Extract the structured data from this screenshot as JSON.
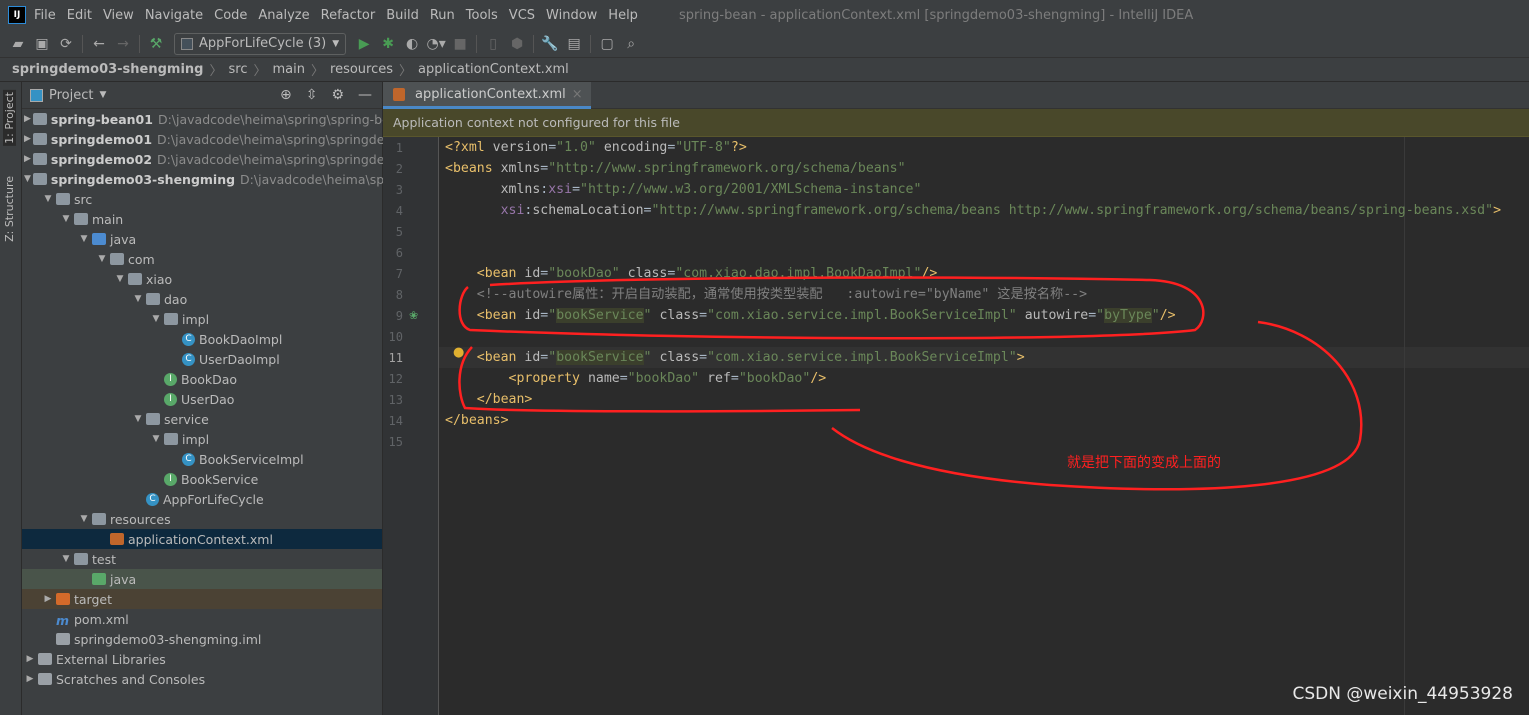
{
  "menubar": {
    "items": [
      "File",
      "Edit",
      "View",
      "Navigate",
      "Code",
      "Analyze",
      "Refactor",
      "Build",
      "Run",
      "Tools",
      "VCS",
      "Window",
      "Help"
    ],
    "window_title": "spring-bean - applicationContext.xml [springdemo03-shengming] - IntelliJ IDEA"
  },
  "toolbar": {
    "run_config": "AppForLifeCycle (3)"
  },
  "breadcrumb": [
    "springdemo03-shengming",
    "src",
    "main",
    "resources",
    "applicationContext.xml"
  ],
  "side_tabs": {
    "project": "1: Project",
    "structure": "Z: Structure"
  },
  "project_panel": {
    "title": "Project",
    "tree": [
      {
        "label": "spring-bean01",
        "path": "D:\\javadcode\\heima\\spring\\spring-bea",
        "level": 0,
        "icon": "module",
        "arrow": "right",
        "bold": true
      },
      {
        "label": "springdemo01",
        "path": "D:\\javadcode\\heima\\spring\\springdem",
        "level": 0,
        "icon": "module",
        "arrow": "right",
        "bold": true
      },
      {
        "label": "springdemo02",
        "path": "D:\\javadcode\\heima\\spring\\springdem",
        "level": 0,
        "icon": "module",
        "arrow": "right",
        "bold": true
      },
      {
        "label": "springdemo03-shengming",
        "path": "D:\\javadcode\\heima\\sprin",
        "level": 0,
        "icon": "module",
        "arrow": "down",
        "bold": true
      },
      {
        "label": "src",
        "level": 1,
        "icon": "folder",
        "arrow": "down"
      },
      {
        "label": "main",
        "level": 2,
        "icon": "folder",
        "arrow": "down"
      },
      {
        "label": "java",
        "level": 3,
        "icon": "source-folder",
        "arrow": "down"
      },
      {
        "label": "com",
        "level": 4,
        "icon": "folder",
        "arrow": "down"
      },
      {
        "label": "xiao",
        "level": 5,
        "icon": "folder",
        "arrow": "down"
      },
      {
        "label": "dao",
        "level": 6,
        "icon": "folder",
        "arrow": "down"
      },
      {
        "label": "impl",
        "level": 7,
        "icon": "folder",
        "arrow": "down"
      },
      {
        "label": "BookDaoImpl",
        "level": 8,
        "icon": "class"
      },
      {
        "label": "UserDaoImpl",
        "level": 8,
        "icon": "class"
      },
      {
        "label": "BookDao",
        "level": 7,
        "icon": "interface"
      },
      {
        "label": "UserDao",
        "level": 7,
        "icon": "interface"
      },
      {
        "label": "service",
        "level": 6,
        "icon": "folder",
        "arrow": "down"
      },
      {
        "label": "impl",
        "level": 7,
        "icon": "folder",
        "arrow": "down"
      },
      {
        "label": "BookServiceImpl",
        "level": 8,
        "icon": "class"
      },
      {
        "label": "BookService",
        "level": 7,
        "icon": "interface"
      },
      {
        "label": "AppForLifeCycle",
        "level": 6,
        "icon": "class"
      },
      {
        "label": "resources",
        "level": 3,
        "icon": "resources-folder",
        "arrow": "down"
      },
      {
        "label": "applicationContext.xml",
        "level": 4,
        "icon": "spring-xml",
        "selected": true
      },
      {
        "label": "test",
        "level": 2,
        "icon": "folder",
        "arrow": "down"
      },
      {
        "label": "java",
        "level": 3,
        "icon": "test-folder",
        "test": true
      },
      {
        "label": "target",
        "level": 1,
        "icon": "target-folder",
        "arrow": "right",
        "target": true
      },
      {
        "label": "pom.xml",
        "level": 1,
        "icon": "maven"
      },
      {
        "label": "springdemo03-shengming.iml",
        "level": 1,
        "icon": "iml-file"
      },
      {
        "label": "External Libraries",
        "level": 0,
        "icon": "libraries",
        "arrow": "right"
      },
      {
        "label": "Scratches and Consoles",
        "level": 0,
        "icon": "scratches",
        "arrow": "right"
      }
    ]
  },
  "editor": {
    "tab": "applicationContext.xml",
    "banner": "Application context not configured for this file",
    "current_line": 11,
    "lines": [
      [
        [
          "tag",
          "<?xml "
        ],
        [
          "attr",
          "version"
        ],
        [
          "p",
          "="
        ],
        [
          "val",
          "\"1.0\""
        ],
        [
          "attr",
          " encoding"
        ],
        [
          "p",
          "="
        ],
        [
          "val",
          "\"UTF-8\""
        ],
        [
          "tag",
          "?>"
        ]
      ],
      [
        [
          "tag",
          "<beans "
        ],
        [
          "attr",
          "xmlns"
        ],
        [
          "p",
          "="
        ],
        [
          "val",
          "\"http://www.springframework.org/schema/beans\""
        ]
      ],
      [
        [
          "p",
          "       "
        ],
        [
          "attr",
          "xmlns"
        ],
        [
          "p",
          ":"
        ],
        [
          "ns",
          "xsi"
        ],
        [
          "p",
          "="
        ],
        [
          "val",
          "\"http://www.w3.org/2001/XMLSchema-instance\""
        ]
      ],
      [
        [
          "p",
          "       "
        ],
        [
          "ns",
          "xsi"
        ],
        [
          "p",
          ":"
        ],
        [
          "attr",
          "schemaLocation"
        ],
        [
          "p",
          "="
        ],
        [
          "val",
          "\"http://www.springframework.org/schema/beans http://www.springframework.org/schema/beans/spring-beans.xsd\""
        ],
        [
          "tag",
          ">"
        ]
      ],
      [],
      [],
      [
        [
          "p",
          "    "
        ],
        [
          "tag",
          "<bean "
        ],
        [
          "attr",
          "id"
        ],
        [
          "p",
          "="
        ],
        [
          "val",
          "\"bookDao\""
        ],
        [
          "attr",
          " class"
        ],
        [
          "p",
          "="
        ],
        [
          "val",
          "\"com.xiao.dao.impl.BookDaoImpl\""
        ],
        [
          "tag",
          "/>"
        ]
      ],
      [
        [
          "p",
          "    "
        ],
        [
          "cm",
          "<!--autowire属性：开启自动装配，通常使用按类型装配   :autowire=\"byName\" 这是按名称-->"
        ]
      ],
      [
        [
          "p",
          "    "
        ],
        [
          "tag",
          "<bean "
        ],
        [
          "attr",
          "id"
        ],
        [
          "p",
          "="
        ],
        [
          "val",
          "\""
        ],
        [
          "hl",
          "bookService"
        ],
        [
          "val",
          "\""
        ],
        [
          "attr",
          " class"
        ],
        [
          "p",
          "="
        ],
        [
          "val",
          "\"com.xiao.service.impl.BookServiceImpl\""
        ],
        [
          "attr",
          " autowire"
        ],
        [
          "p",
          "="
        ],
        [
          "val",
          "\""
        ],
        [
          "hl",
          "byType"
        ],
        [
          "val",
          "\""
        ],
        [
          "tag",
          "/>"
        ]
      ],
      [],
      [
        [
          "p",
          "    "
        ],
        [
          "tag",
          "<bean "
        ],
        [
          "attr",
          "id"
        ],
        [
          "p",
          "="
        ],
        [
          "val",
          "\""
        ],
        [
          "hl",
          "bookService"
        ],
        [
          "val",
          "\""
        ],
        [
          "attr",
          " class"
        ],
        [
          "p",
          "="
        ],
        [
          "val",
          "\"com.xiao.service.impl.BookServiceImpl\""
        ],
        [
          "tag",
          ">"
        ]
      ],
      [
        [
          "p",
          "        "
        ],
        [
          "tag",
          "<property "
        ],
        [
          "attr",
          "name"
        ],
        [
          "p",
          "="
        ],
        [
          "val",
          "\"bookDao\""
        ],
        [
          "attr",
          " ref"
        ],
        [
          "p",
          "="
        ],
        [
          "val",
          "\"bookDao\""
        ],
        [
          "tag",
          "/>"
        ]
      ],
      [
        [
          "p",
          "    "
        ],
        [
          "tag",
          "</bean>"
        ]
      ],
      [
        [
          "tag",
          "</beans>"
        ]
      ],
      []
    ]
  },
  "annotation": {
    "note": "就是把下面的变成上面的",
    "color": "#ff2020"
  },
  "watermark": "CSDN @weixin_44953928"
}
